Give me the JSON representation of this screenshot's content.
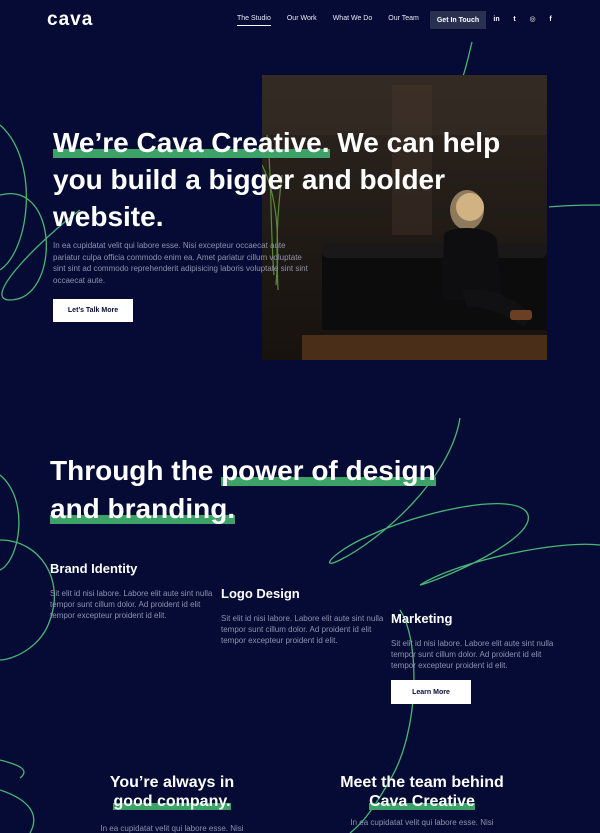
{
  "brand": {
    "logo": "cava"
  },
  "nav": {
    "items": [
      "The Studio",
      "Our Work",
      "What We Do",
      "Our Team"
    ],
    "cta": "Get In Touch",
    "social": [
      {
        "icon": "linkedin-icon",
        "glyph": "in"
      },
      {
        "icon": "twitter-icon",
        "glyph": "t"
      },
      {
        "icon": "instagram-icon",
        "glyph": "◎"
      },
      {
        "icon": "facebook-icon",
        "glyph": "f"
      }
    ]
  },
  "hero": {
    "title_highlight": "We’re Cava Creative.",
    "title_rest": " We can help you build a bigger and bolder website.",
    "text": "In ea cupidatat velit qui labore esse. Nisi excepteur occaecat aute pariatur culpa officia commodo enim ea. Amet pariatur cillum voluptate sint sint ad commodo reprehenderit adipisicing laboris voluptate sint sint occaecat aute.",
    "button": "Let’s Talk More"
  },
  "section2": {
    "title_plain": "Through the ",
    "title_highlight_1": "power of design",
    "title_highlight_2": "and branding.",
    "services": [
      {
        "title": "Brand Identity",
        "text": "Sit elit id nisi labore. Labore elit aute sint nulla tempor sunt cillum dolor. Ad proident id elit tempor excepteur proident id elit."
      },
      {
        "title": "Logo Design",
        "text": "Sit elit id nisi labore. Labore elit aute sint nulla tempor sunt cillum dolor. Ad proident id elit tempor excepteur proident id elit."
      },
      {
        "title": "Marketing",
        "text": "Sit elit id nisi labore. Labore elit aute sint nulla tempor sunt cillum dolor. Ad proident id elit tempor excepteur proident id elit."
      }
    ],
    "button": "Learn More"
  },
  "bottom": {
    "left_title": "You’re always in",
    "left_highlight": "good company.",
    "left_text": "In ea cupidatat velit qui labore esse. Nisi",
    "right_title": "Meet the team behind",
    "right_highlight": "Cava Creative",
    "right_text": "In ea cupidatat velit qui labore esse. Nisi"
  },
  "colors": {
    "background": "#050b34",
    "accent": "#3da268",
    "muted_text": "#8d93ad",
    "button_dark": "#2a3050"
  }
}
